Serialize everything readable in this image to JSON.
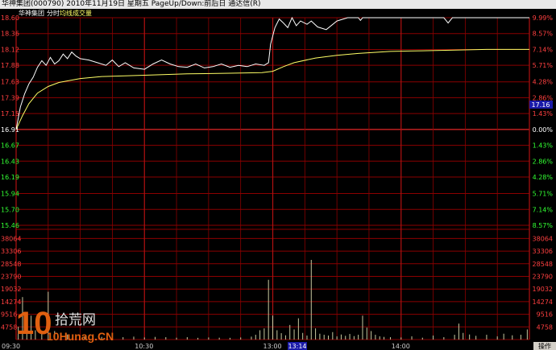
{
  "window": {
    "title": "华神集团(000790) 2010年11月19日 星期五 PageUp/Down:前后日 通达信(R)"
  },
  "legend": {
    "name": "华神集团",
    "mode": "分时",
    "avg_line": "均线",
    "volume": "成交量"
  },
  "colors": {
    "background": "#000000",
    "grid": "#8b0000",
    "price_line": "#ffffff",
    "avg_line": "#ffff66",
    "up_text": "#ff4040",
    "flat_text": "#ffffff",
    "down_text": "#33ff33",
    "volume_bar": "#c8c8a0",
    "current_price_box": "#1a1aa8"
  },
  "current_price": "17.16",
  "time_labels": [
    "09:30",
    "10:30",
    "13:00",
    "14:00"
  ],
  "cursor_time": "13:14",
  "operate_button": "操作",
  "logo_text": "拾荒网",
  "logo_url": "10Hunag.CN",
  "chart_data": {
    "type": "line",
    "prev_close": 16.91,
    "price_ticks_left": [
      "18.60",
      "18.36",
      "18.12",
      "17.88",
      "17.63",
      "17.39",
      "17.15",
      "16.91",
      "16.67",
      "16.43",
      "16.19",
      "15.94",
      "15.70",
      "15.46"
    ],
    "price_ticks_right": [
      "9.99%",
      "8.57%",
      "7.14%",
      "5.71%",
      "4.28%",
      "2.86%",
      "1.43%",
      "0.00%",
      "1.43%",
      "2.86%",
      "4.28%",
      "5.71%",
      "7.14%",
      "8.57%"
    ],
    "volume_ticks": [
      "38064",
      "33306",
      "28548",
      "23790",
      "19032",
      "14274",
      "9516",
      "4758"
    ],
    "ylim": [
      15.46,
      18.6
    ],
    "minutes": 240,
    "series": [
      {
        "name": "price",
        "points": [
          [
            0,
            16.91
          ],
          [
            2,
            17.25
          ],
          [
            4,
            17.45
          ],
          [
            6,
            17.6
          ],
          [
            8,
            17.7
          ],
          [
            10,
            17.85
          ],
          [
            12,
            17.95
          ],
          [
            14,
            17.88
          ],
          [
            16,
            18.0
          ],
          [
            18,
            17.9
          ],
          [
            20,
            17.95
          ],
          [
            22,
            18.05
          ],
          [
            24,
            17.98
          ],
          [
            26,
            18.08
          ],
          [
            28,
            18.02
          ],
          [
            30,
            17.98
          ],
          [
            34,
            17.96
          ],
          [
            38,
            17.92
          ],
          [
            42,
            17.88
          ],
          [
            45,
            17.96
          ],
          [
            48,
            17.86
          ],
          [
            51,
            17.92
          ],
          [
            55,
            17.84
          ],
          [
            60,
            17.82
          ],
          [
            64,
            17.9
          ],
          [
            68,
            17.96
          ],
          [
            72,
            17.9
          ],
          [
            76,
            17.86
          ],
          [
            80,
            17.85
          ],
          [
            84,
            17.9
          ],
          [
            88,
            17.84
          ],
          [
            92,
            17.86
          ],
          [
            96,
            17.9
          ],
          [
            100,
            17.85
          ],
          [
            104,
            17.88
          ],
          [
            108,
            17.86
          ],
          [
            112,
            17.9
          ],
          [
            116,
            17.88
          ],
          [
            118,
            17.92
          ],
          [
            119,
            18.2
          ],
          [
            121,
            18.45
          ],
          [
            123,
            18.58
          ],
          [
            125,
            18.52
          ],
          [
            127,
            18.45
          ],
          [
            129,
            18.6
          ],
          [
            131,
            18.48
          ],
          [
            133,
            18.55
          ],
          [
            136,
            18.5
          ],
          [
            138,
            18.55
          ],
          [
            141,
            18.46
          ],
          [
            145,
            18.42
          ],
          [
            150,
            18.55
          ],
          [
            155,
            18.6
          ],
          [
            160,
            18.6
          ],
          [
            161,
            18.56
          ],
          [
            162,
            18.6
          ],
          [
            200,
            18.6
          ],
          [
            201,
            18.56
          ],
          [
            202,
            18.52
          ],
          [
            204,
            18.6
          ],
          [
            240,
            18.6
          ]
        ]
      },
      {
        "name": "avg",
        "points": [
          [
            0,
            16.91
          ],
          [
            3,
            17.12
          ],
          [
            6,
            17.3
          ],
          [
            10,
            17.46
          ],
          [
            15,
            17.56
          ],
          [
            20,
            17.62
          ],
          [
            30,
            17.68
          ],
          [
            40,
            17.71
          ],
          [
            60,
            17.73
          ],
          [
            80,
            17.75
          ],
          [
            100,
            17.76
          ],
          [
            115,
            17.77
          ],
          [
            120,
            17.79
          ],
          [
            125,
            17.86
          ],
          [
            130,
            17.92
          ],
          [
            140,
            17.99
          ],
          [
            150,
            18.03
          ],
          [
            160,
            18.06
          ],
          [
            175,
            18.09
          ],
          [
            190,
            18.1
          ],
          [
            205,
            18.11
          ],
          [
            220,
            18.12
          ],
          [
            240,
            18.12
          ]
        ]
      },
      {
        "name": "volume",
        "points": [
          [
            1,
            4800
          ],
          [
            3,
            16000
          ],
          [
            5,
            2800
          ],
          [
            7,
            9000
          ],
          [
            9,
            3500
          ],
          [
            12,
            2200
          ],
          [
            15,
            18000
          ],
          [
            18,
            3200
          ],
          [
            21,
            2500
          ],
          [
            24,
            1900
          ],
          [
            28,
            1600
          ],
          [
            32,
            1200
          ],
          [
            36,
            1500
          ],
          [
            40,
            1000
          ],
          [
            45,
            1300
          ],
          [
            50,
            900
          ],
          [
            55,
            1100
          ],
          [
            60,
            800
          ],
          [
            65,
            1000
          ],
          [
            70,
            900
          ],
          [
            75,
            700
          ],
          [
            80,
            900
          ],
          [
            85,
            650
          ],
          [
            90,
            800
          ],
          [
            95,
            700
          ],
          [
            100,
            650
          ],
          [
            105,
            800
          ],
          [
            110,
            1100
          ],
          [
            112,
            1800
          ],
          [
            114,
            3500
          ],
          [
            116,
            4200
          ],
          [
            118,
            22500
          ],
          [
            120,
            9000
          ],
          [
            122,
            3500
          ],
          [
            124,
            2400
          ],
          [
            126,
            1600
          ],
          [
            128,
            5500
          ],
          [
            130,
            3800
          ],
          [
            132,
            8000
          ],
          [
            134,
            2500
          ],
          [
            136,
            1500
          ],
          [
            138,
            30000
          ],
          [
            140,
            4200
          ],
          [
            142,
            2200
          ],
          [
            144,
            1800
          ],
          [
            146,
            1500
          ],
          [
            148,
            2800
          ],
          [
            150,
            1200
          ],
          [
            152,
            1900
          ],
          [
            154,
            1400
          ],
          [
            156,
            2100
          ],
          [
            158,
            1300
          ],
          [
            160,
            1800
          ],
          [
            162,
            9000
          ],
          [
            164,
            4500
          ],
          [
            166,
            3200
          ],
          [
            168,
            1800
          ],
          [
            170,
            1200
          ],
          [
            172,
            1000
          ],
          [
            175,
            900
          ],
          [
            180,
            800
          ],
          [
            185,
            1200
          ],
          [
            190,
            700
          ],
          [
            195,
            1500
          ],
          [
            200,
            900
          ],
          [
            205,
            1800
          ],
          [
            207,
            6000
          ],
          [
            209,
            2500
          ],
          [
            212,
            1900
          ],
          [
            215,
            1400
          ],
          [
            220,
            1800
          ],
          [
            225,
            1200
          ],
          [
            228,
            2200
          ],
          [
            232,
            1600
          ],
          [
            236,
            1800
          ],
          [
            239,
            3800
          ]
        ]
      }
    ],
    "volume_max": 40000
  }
}
